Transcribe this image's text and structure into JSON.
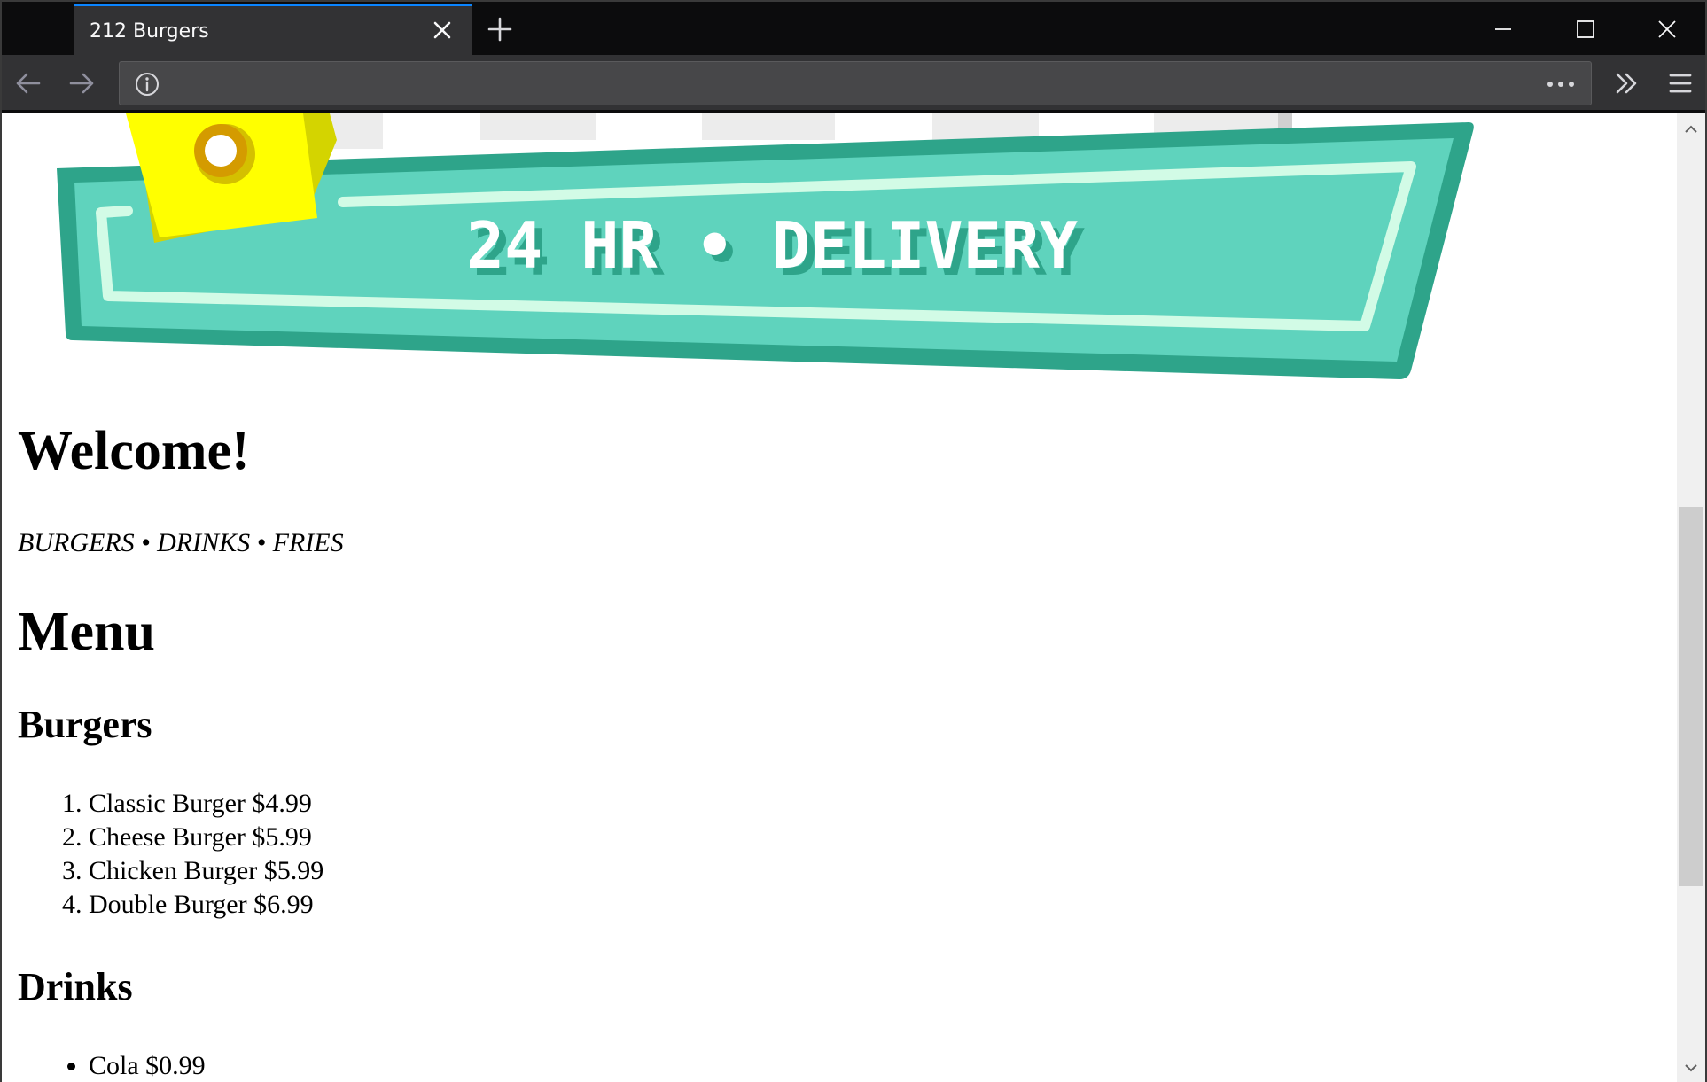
{
  "browser": {
    "tab_title": "212 Burgers"
  },
  "banner": {
    "text": "24 HR • DELIVERY",
    "colors": {
      "teal_dark": "#2ea48a",
      "teal": "#5fd3bd",
      "stripe": "#d2fbe6",
      "yellow": "#ffff00",
      "yellow_dark": "#d4d400",
      "ring": "#d49b00"
    }
  },
  "page": {
    "welcome": "Welcome!",
    "tagline": "BURGERS • DRINKS • FRIES",
    "menu_heading": "Menu",
    "burgers_heading": "Burgers",
    "burgers": [
      "Classic Burger $4.99",
      "Cheese Burger $5.99",
      "Chicken Burger $5.99",
      "Double Burger $6.99"
    ],
    "drinks_heading": "Drinks",
    "drinks": [
      "Cola $0.99"
    ]
  },
  "icons": {
    "tab_close": "close-icon",
    "new_tab": "plus-icon",
    "back": "arrow-left-icon",
    "forward": "arrow-right-icon",
    "info": "info-icon",
    "page_actions": "more-dots-icon",
    "overflow": "double-chevron-right-icon",
    "menu": "hamburger-icon"
  }
}
